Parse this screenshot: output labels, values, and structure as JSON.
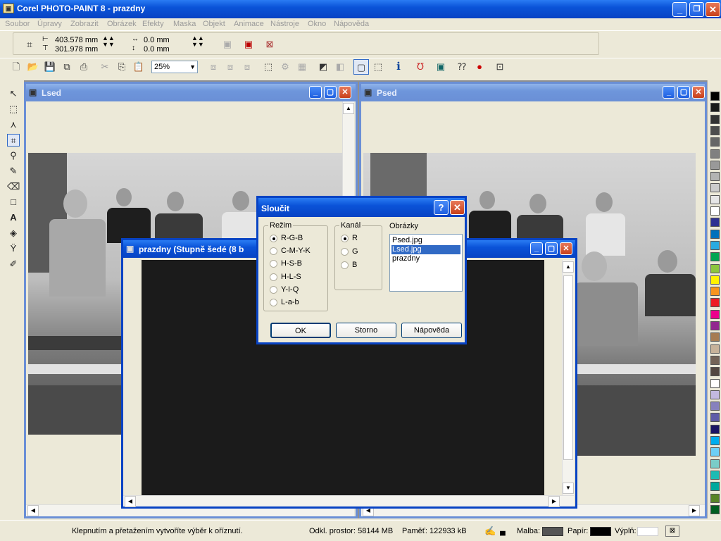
{
  "app": {
    "title": "Corel PHOTO-PAINT 8 - prazdny",
    "controls": {
      "minimize": "_",
      "restore": "❐",
      "close": "✕"
    }
  },
  "menu": [
    "Soubor",
    "Úpravy",
    "Zobrazit",
    "Obrázek",
    "Efekty",
    "Maska",
    "Objekt",
    "Animace",
    "Nástroje",
    "Okno",
    "Nápověda"
  ],
  "property_bar": {
    "width": "403.578 mm",
    "height": "301.978 mm",
    "x": "0.0 mm",
    "y": "0.0 mm"
  },
  "toolbar": {
    "zoom": "25%"
  },
  "windows": {
    "lsed": {
      "title": "Lsed"
    },
    "psed": {
      "title": "Psed"
    },
    "prazdny": {
      "title": "prazdny  (Stupně šedé (8 b"
    }
  },
  "dialog": {
    "title": "Sloučit",
    "help_glyph": "?",
    "mode_group": "Režim",
    "modes": [
      "R-G-B",
      "C-M-Y-K",
      "H-S-B",
      "H-L-S",
      "Y-I-Q",
      "L-a-b"
    ],
    "channel_group": "Kanál",
    "channels": [
      "R",
      "G",
      "B"
    ],
    "images_label": "Obrázky",
    "images": [
      "Psed.jpg",
      "Lsed.jpg",
      "prazdny"
    ],
    "ok": "OK",
    "cancel": "Storno",
    "help": "Nápověda"
  },
  "status": {
    "hint": "Klepnutím a přetažením vytvoříte výběr k oříznutí.",
    "disk": "Odkl. prostor: 58144 MB",
    "memory": "Paměť: 122933 kB",
    "paint": "Malba:",
    "paper": "Papír:",
    "fill": "Výplň:"
  },
  "colors": {
    "titlebar": "#0a53d8",
    "selection": "#316ac5",
    "paint_swatch": "#555555",
    "paper_swatch": "#000000",
    "fill_swatch": "#ffffff"
  },
  "palette": [
    "#000000",
    "#1a1a1a",
    "#333333",
    "#4d4d4d",
    "#666666",
    "#808080",
    "#999999",
    "#b3b3b3",
    "#cccccc",
    "#e6e6e6",
    "#ffffff",
    "#2e3192",
    "#0071bc",
    "#29abe2",
    "#00a651",
    "#8dc63f",
    "#fff200",
    "#f7941d",
    "#ed1c24",
    "#ec008c",
    "#92278f",
    "#a67c52",
    "#c7b299",
    "#736357",
    "#534741",
    "#ffffff",
    "#c2b9e0",
    "#8781bd",
    "#605ca8",
    "#1b1464",
    "#00aeef",
    "#6dcff6",
    "#7accc8",
    "#1cbbb4",
    "#00a99d",
    "#598527",
    "#005e20"
  ]
}
